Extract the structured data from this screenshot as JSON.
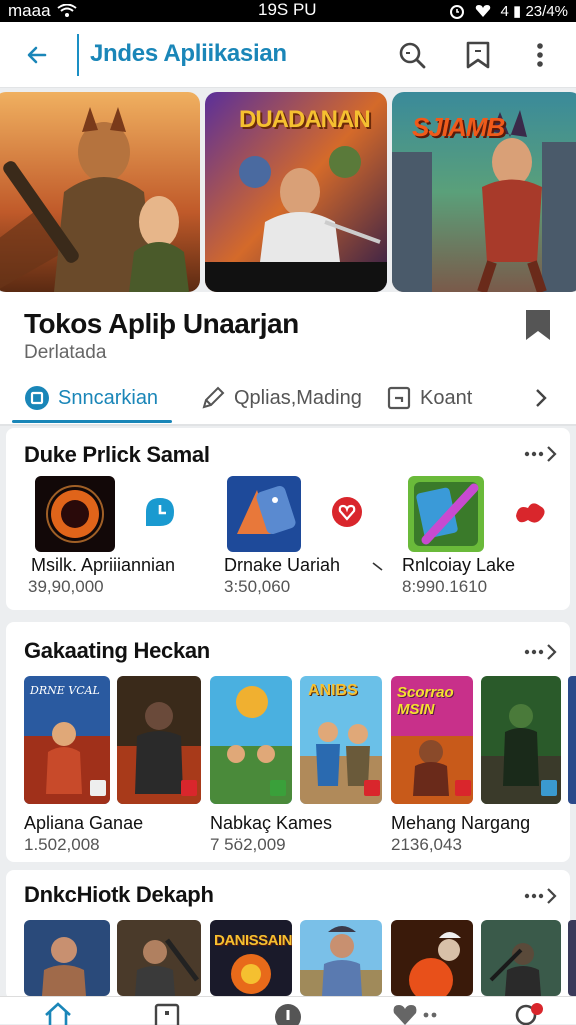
{
  "status_bar": {
    "carrier": "maaa",
    "time": "19S PU",
    "battery_text": "4 ▮ 23/4%"
  },
  "app_bar": {
    "title": "Jndes Apliikasian",
    "back_icon": "arrow-left-icon",
    "search_icon": "search-icon",
    "bookmark_icon": "bookmark-icon",
    "menu_icon": "more-vertical-icon"
  },
  "banners": [
    {
      "name": "banner-warrior",
      "caption": ""
    },
    {
      "name": "banner-duadanan",
      "caption": "DUADANAN"
    },
    {
      "name": "banner-sjiamb",
      "caption": "SJIAMB"
    }
  ],
  "store_card": {
    "title": "Tokos Apliþ Unaarjan",
    "subtitle": "Derlatada",
    "tabs": [
      {
        "label": "Snncarkian",
        "icon": "square-icon",
        "active": true
      },
      {
        "label": "Qplias,Mading",
        "icon": "pencil-icon",
        "active": false
      },
      {
        "label": "Koant",
        "icon": "box-icon",
        "active": false
      }
    ]
  },
  "section1": {
    "title": "Duke Prlick Samal",
    "items": [
      {
        "name": "Msilk. Apriiiannian",
        "count": "39,90,000"
      },
      {
        "name": "Drnake Uariah",
        "count": "3:50,060"
      },
      {
        "name": "Rnlcoiay Lake",
        "count": "8:990.1610"
      }
    ]
  },
  "section2": {
    "title": "Gakaating Heckan",
    "tile_captions": [
      "DRNE VCAL",
      "",
      "",
      "ANIBS",
      "Scorrao MSIN",
      ""
    ],
    "items": [
      {
        "name": "Apliana Ganae",
        "count": "1.502,008"
      },
      {
        "name": "Nabkaç Kames",
        "count": "7 5ö2,009"
      },
      {
        "name": "Mehang Nargang",
        "count": "2136,043"
      }
    ]
  },
  "section3": {
    "title": "DnkcHiotk Dekaph",
    "tile_captions": [
      "",
      "",
      "DANISSAINS",
      "",
      "",
      ""
    ]
  },
  "colors": {
    "accent": "#1a86b8",
    "badge_red": "#d9262c"
  }
}
